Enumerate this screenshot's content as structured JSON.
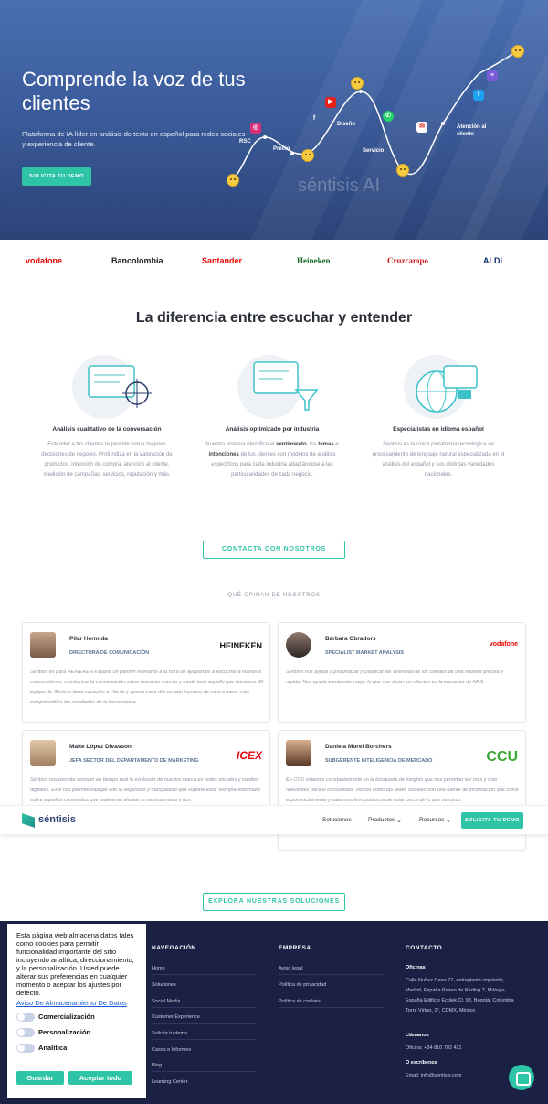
{
  "hero": {
    "title": "Comprende la voz de tus clientes",
    "subtitle": "Plataforma de IA líder en análisis de texto en español para redes sociales y experiencia de cliente.",
    "cta": "SOLICITA TU DEMO",
    "labels": {
      "rsc": "RSC",
      "precio": "Precio",
      "diseno": "Diseño",
      "servicio": "Servicio",
      "atencion": "Atención al cliente"
    },
    "watermark": "séntisis AI"
  },
  "logos": [
    "vodafone",
    "Bancolombia",
    "Santander",
    "Heineken",
    "Cruzcampo",
    "ALDI"
  ],
  "difference": {
    "title": "La diferencia entre escuchar y entender",
    "features": [
      {
        "title": "Análisis cualitativo de la conversación",
        "text": "Entender a tus clientes te permite tomar mejores decisiones de negocio. Profundiza en la valoración de productos, intención de compra, atención al cliente, medición de campañas, servicios, reputación y más."
      },
      {
        "title": "Análisis optimizado por industria",
        "text_a": "Nuestro sistema identifica el ",
        "bold1": "sentimiento",
        "text_b": ", los ",
        "bold2": "temas",
        "text_c": " e ",
        "bold3": "intenciones",
        "text_d": " de tus clientes con modelos de análisis específicos para cada industria adaptándose a las particularidades de cada negocio."
      },
      {
        "title": "Especialistas en idioma español",
        "text": "Séntisis es la única plataforma tecnológica de procesamiento de lenguaje natural especializada en el análisis del español y sus distintas variedades nacionales."
      }
    ],
    "cta": "CONTACTA CON NOSOTROS"
  },
  "testimonials": {
    "heading": "QUÉ OPINAN DE NOSOTROS",
    "items": [
      {
        "name": "Pilar Hermida",
        "role": "DIRECTORA DE COMUNICACIÓN",
        "brand": "HEINEKEN",
        "quote": "Séntisis es para HEINEKEN España un partner relevante a la hora de ayudarnos a escuchar a nuestros consumidores, monitorizar la conversación sobre nuestras marcas y medir todo aquello que hacemos. El equipo de Séntisis tiene vocación a cliente y aporta cada día su lado humano de cara a hacer más comprensibles los resultados de la herramienta."
      },
      {
        "name": "Bárbara Obradors",
        "role": "SPECIALIST MARKET ANALYSIS",
        "brand": "vodafone",
        "quote": "Séntisis nos ayuda a profundizar y clasificar las vivencias de los clientes de una manera precisa y rápida. Nos ayuda a entender mejor lo que nos dicen los clientes en la encuesta de NPS."
      },
      {
        "name": "Maite López Divasson",
        "role": "JEFA SECTOR DEL DEPARTAMENTO DE MARKETING",
        "brand": "ICEX",
        "quote": "Séntisis nos permite conocer en tiempo real la evolución de nuestra marca en redes sociales y medios digitales. Esto nos permite trabajar con la seguridad y tranquilidad que supone estar siempre informado sobre aquellos contenidos que realmente afectan a nuestra marca y nos"
      },
      {
        "name": "Daniela Morel Borchers",
        "role": "SUBGERENTE INTELIGENCIA DE MERCADO",
        "brand": "CCU",
        "quote": "En CCU estamos constantemente en la búsqueda de insights que nos permitan ser más y más relevantes para el consumidor. Vemos cómo las redes sociales son una fuente de información que crece exponencialmente y sabemos la importancia de estar cerca de lo que nuestros"
      }
    ],
    "cta": "EXPLORA NUESTRAS SOLUCIONES"
  },
  "navbar": {
    "brand": "séntisis",
    "items": [
      "Soluciones",
      "Productos",
      "Recursos"
    ],
    "cta": "SOLICITA TU DEMO"
  },
  "footer": {
    "nav_title": "NAVEGACIÓN",
    "nav_links": [
      "Home",
      "Soluciones",
      "Social Media",
      "Customer Experience",
      "Solicita tu demo",
      "Casos e Informes",
      "Blog",
      "Learning Center"
    ],
    "company_title": "EMPRESA",
    "company_links": [
      "Aviso legal",
      "Política de privacidad",
      "Política de cookies"
    ],
    "contact_title": "CONTACTO",
    "offices_label": "Oficinas",
    "offices_text": "Calle Nuñez Cano 27, entreplanta izquierda, Madrid, España Paseo de Reding 7, Málaga, España Edificio Ecolek Cl. 98, Bogotá, Colombia Torre Virtuo, 1°, CDMX, México",
    "call_label": "Llámanos",
    "call_text": "Oficina: +34 810 702 421",
    "write_label": "O escríbenos",
    "write_text": "Email: info@sentisis.com"
  },
  "cookie": {
    "text": "Esta página web almacena datos tales como cookies para permitir funcionalidad importante del sitio incluyendo analítica, direccionamiento, y la personalización. Usted puede alterar sus preferencias en cualquier momento o aceptar los ajustes por defecto.",
    "link": "Aviso De Almacenamiento De Datos",
    "toggles": [
      "Comercialización",
      "Personalización",
      "Analítica"
    ],
    "save": "Guardar",
    "accept": "Aceptar todo"
  },
  "colors": {
    "accent": "#2ec4a6",
    "hero": "#3b5c9c",
    "footer": "#1a2145"
  }
}
